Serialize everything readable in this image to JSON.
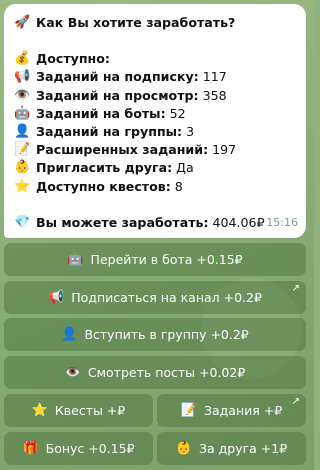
{
  "message": {
    "title": "Как Вы хотите заработать?",
    "title_icon": "🚀",
    "available_label": "Доступно:",
    "available_icon": "💰",
    "stats": [
      {
        "icon": "📢",
        "label": "Заданий на подписку:",
        "value": "117"
      },
      {
        "icon": "👁️",
        "label": "Заданий на просмотр:",
        "value": "358"
      },
      {
        "icon": "🤖",
        "label": "Заданий на боты:",
        "value": "52"
      },
      {
        "icon": "👤",
        "label": "Заданий на группы:",
        "value": "3"
      },
      {
        "icon": "📝",
        "label": "Расширенных заданий:",
        "value": "197"
      },
      {
        "icon": "👶",
        "label": "Пригласить друга:",
        "value": "Да"
      },
      {
        "icon": "⭐",
        "label": "Доступно квестов:",
        "value": "8"
      }
    ],
    "earn_icon": "💎",
    "earn_label": "Вы можете заработать:",
    "earn_value": "404.06₽",
    "time": "15:16"
  },
  "buttons": {
    "go_bot": {
      "icon": "🤖",
      "label": "Перейти в бота +0.15₽"
    },
    "subscribe": {
      "icon": "📢",
      "label": "Подписаться на канал +0.2₽",
      "arrow": "↗"
    },
    "join_group": {
      "icon": "👤",
      "label": "Вступить в группу +0.2₽"
    },
    "watch_posts": {
      "icon": "👁️",
      "label": "Смотреть посты +0.02₽"
    },
    "quests": {
      "icon": "⭐",
      "label": "Квесты +₽"
    },
    "tasks": {
      "icon": "📝",
      "label": "Задания +₽",
      "arrow": "↗"
    },
    "bonus": {
      "icon": "🎁",
      "label": "Бонус +0.15₽"
    },
    "friend": {
      "icon": "👶",
      "label": "За друга +1₽"
    }
  },
  "colors": {
    "background": "#8fb27c",
    "bubble": "#ffffff",
    "button": "rgba(70,110,55,0.45)"
  }
}
